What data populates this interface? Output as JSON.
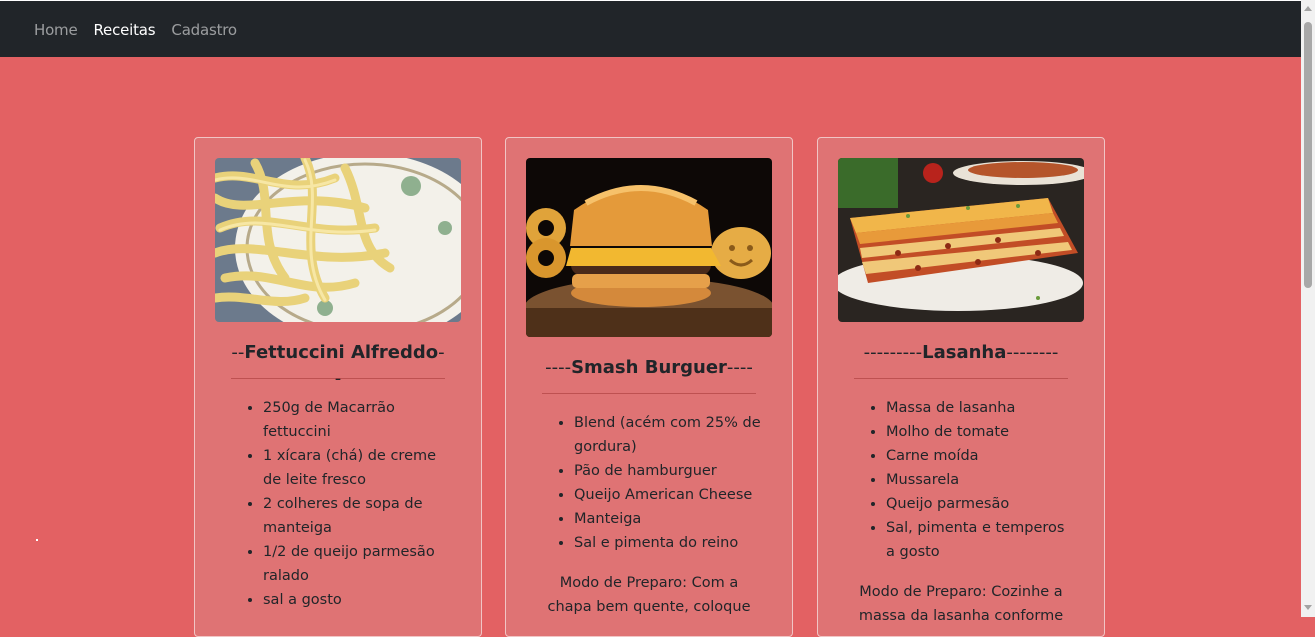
{
  "nav": {
    "items": [
      {
        "label": "Home",
        "active": false
      },
      {
        "label": "Receitas",
        "active": true
      },
      {
        "label": "Cadastro",
        "active": false
      }
    ]
  },
  "colors": {
    "navbar": "#212529",
    "background": "#e36163",
    "card": "#df7374"
  },
  "recipes": [
    {
      "title_prefix": "--",
      "title": "Fettuccini Alfreddo",
      "title_suffix": "--",
      "image": "fettuccine-alfredo-photo",
      "ingredients": [
        "250g de Macarrão fettuccini",
        "1 xícara (chá) de creme de leite fresco",
        "2 colheres de sopa de manteiga",
        "1/2 de queijo parmesão ralado",
        "sal a gosto"
      ],
      "prep": ""
    },
    {
      "title_prefix": "----",
      "title": "Smash Burguer",
      "title_suffix": "----",
      "image": "smash-burger-photo",
      "ingredients": [
        "Blend (acém com 25% de gordura)",
        "Pão de hamburguer",
        "Queijo American Cheese",
        "Manteiga",
        "Sal e pimenta do reino"
      ],
      "prep": "Modo de Preparo: Com a chapa bem quente, coloque"
    },
    {
      "title_prefix": "---------",
      "title": "Lasanha",
      "title_suffix": "--------",
      "image": "lasagna-photo",
      "ingredients": [
        "Massa de lasanha",
        "Molho de tomate",
        "Carne moída",
        "Mussarela",
        "Queijo parmesão",
        "Sal, pimenta e temperos a gosto"
      ],
      "prep": "Modo de Preparo: Cozinhe a massa da lasanha conforme"
    }
  ]
}
